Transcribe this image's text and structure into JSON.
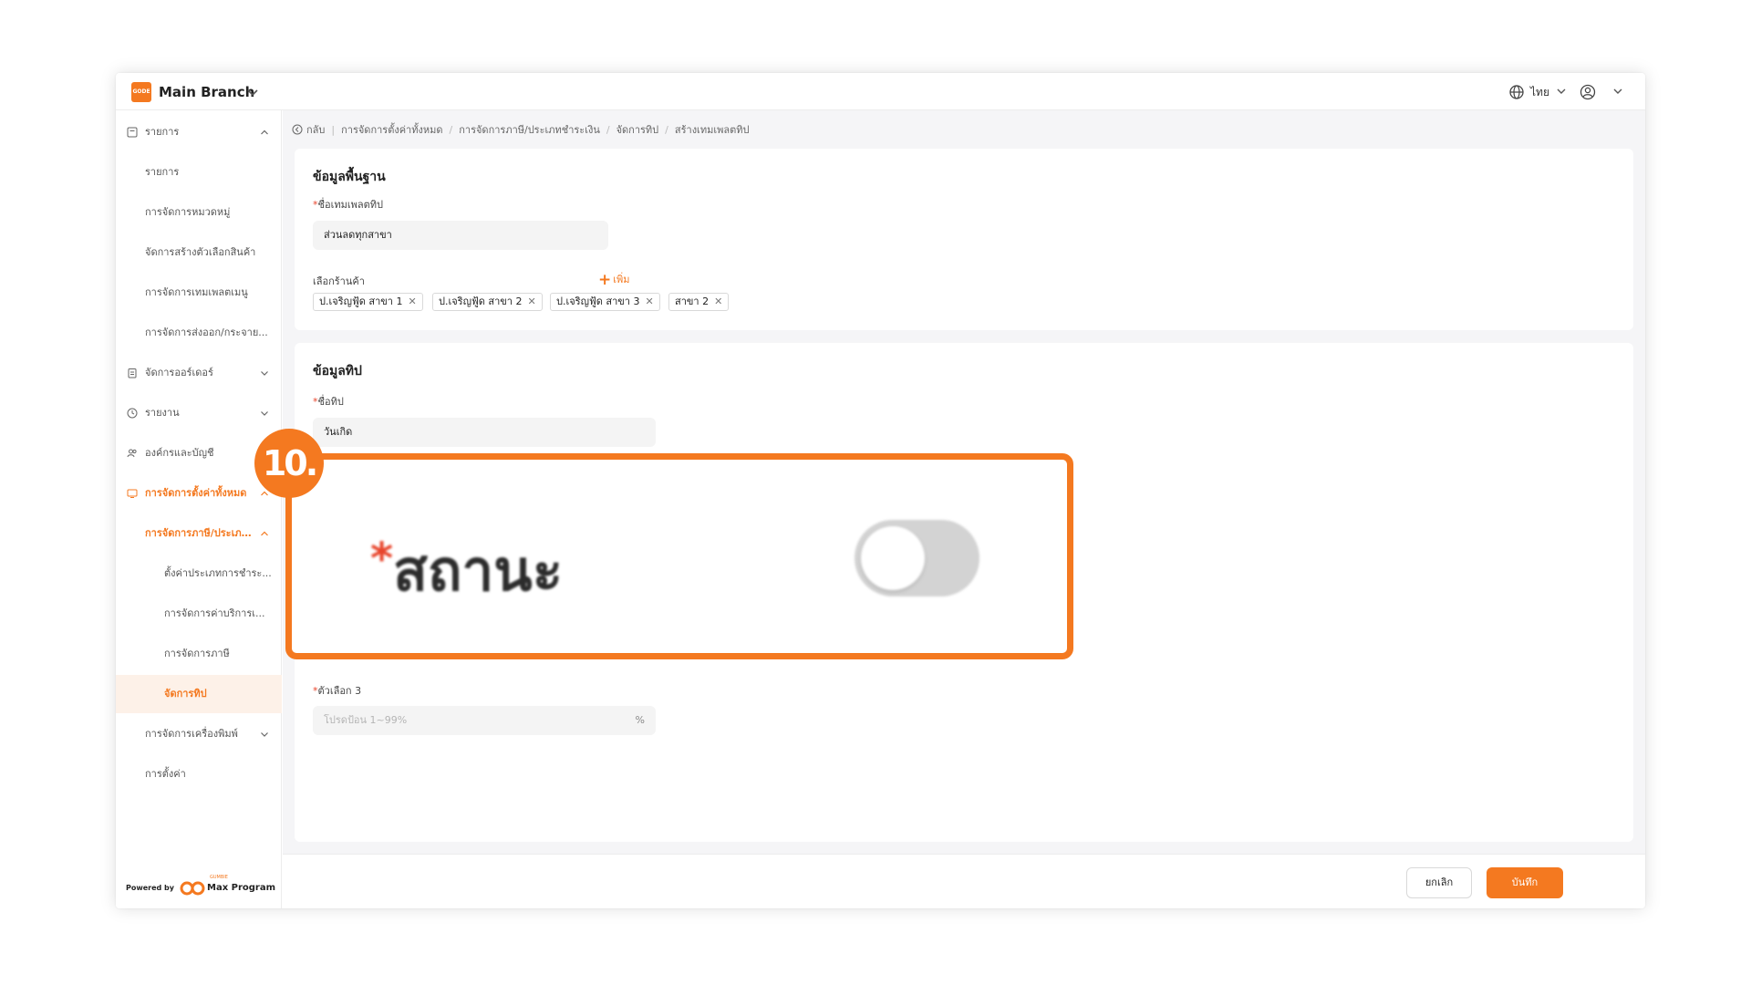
{
  "header": {
    "branch": "Main Branch",
    "logo_text": "GODE",
    "language": "ไทย"
  },
  "sidebar": {
    "items": [
      {
        "label": "รายการ"
      },
      {
        "label": "รายการ"
      },
      {
        "label": "การจัดการหมวดหมู่"
      },
      {
        "label": "จัดการสร้างตัวเลือกสินค้า"
      },
      {
        "label": "การจัดการเทมเพลตเมนู"
      },
      {
        "label": "การจัดการส่งออก/กระจาย..."
      },
      {
        "label": "จัดการออร์เดอร์"
      },
      {
        "label": "รายงาน"
      },
      {
        "label": "องค์กรและบัญชี"
      },
      {
        "label": "การจัดการตั้งค่าทั้งหมด"
      },
      {
        "label": "การจัดการภาษี/ประเภ..."
      },
      {
        "label": "ตั้งค่าประเภทการชำระ..."
      },
      {
        "label": "การจัดการค่าบริการเ..."
      },
      {
        "label": "การจัดการภาษี"
      },
      {
        "label": "จัดการทิป"
      },
      {
        "label": "การจัดการเครื่องพิมพ์"
      },
      {
        "label": "การตั้งค่า"
      }
    ],
    "powered_by": "Powered by",
    "max_small": "GUMBIE",
    "max_program": "Max Program"
  },
  "breadcrumb": {
    "back": "กลับ",
    "items": [
      "การจัดการตั้งค่าทั้งหมด",
      "การจัดการภาษี/ประเภทชำระเงิน",
      "จัดการทิป",
      "สร้างเทมเพลตทิป"
    ]
  },
  "basic_info": {
    "title": "ข้อมูลพื้นฐาน",
    "template_name_label": "ชื่อเทมเพลตทิป",
    "template_name_value": "ส่วนลดทุกสาขา",
    "store_label": "เลือกร้านค้า",
    "add_label": "เพิ่ม",
    "tags": [
      "ป.เจริญฟู้ด สาขา 1",
      "ป.เจริญฟู้ด สาขา 2",
      "ป.เจริญฟู้ด สาขา 3",
      "สาขา 2"
    ]
  },
  "tip_info": {
    "title": "ข้อมูลทิป",
    "tip_name_label": "ชื่อทิป",
    "tip_name_value": "วันเกิด",
    "option3_label": "ตัวเลือก 3",
    "option3_placeholder": "โปรดป้อน 1~99%",
    "option3_suffix": "%"
  },
  "footer": {
    "cancel": "ยกเลิก",
    "save": "บันทึก"
  },
  "callout": {
    "step": "10.",
    "label": "สถานะ",
    "required_mark": "*",
    "toggle_on": false
  },
  "colors": {
    "accent": "#f47920",
    "required": "#e8452c"
  }
}
